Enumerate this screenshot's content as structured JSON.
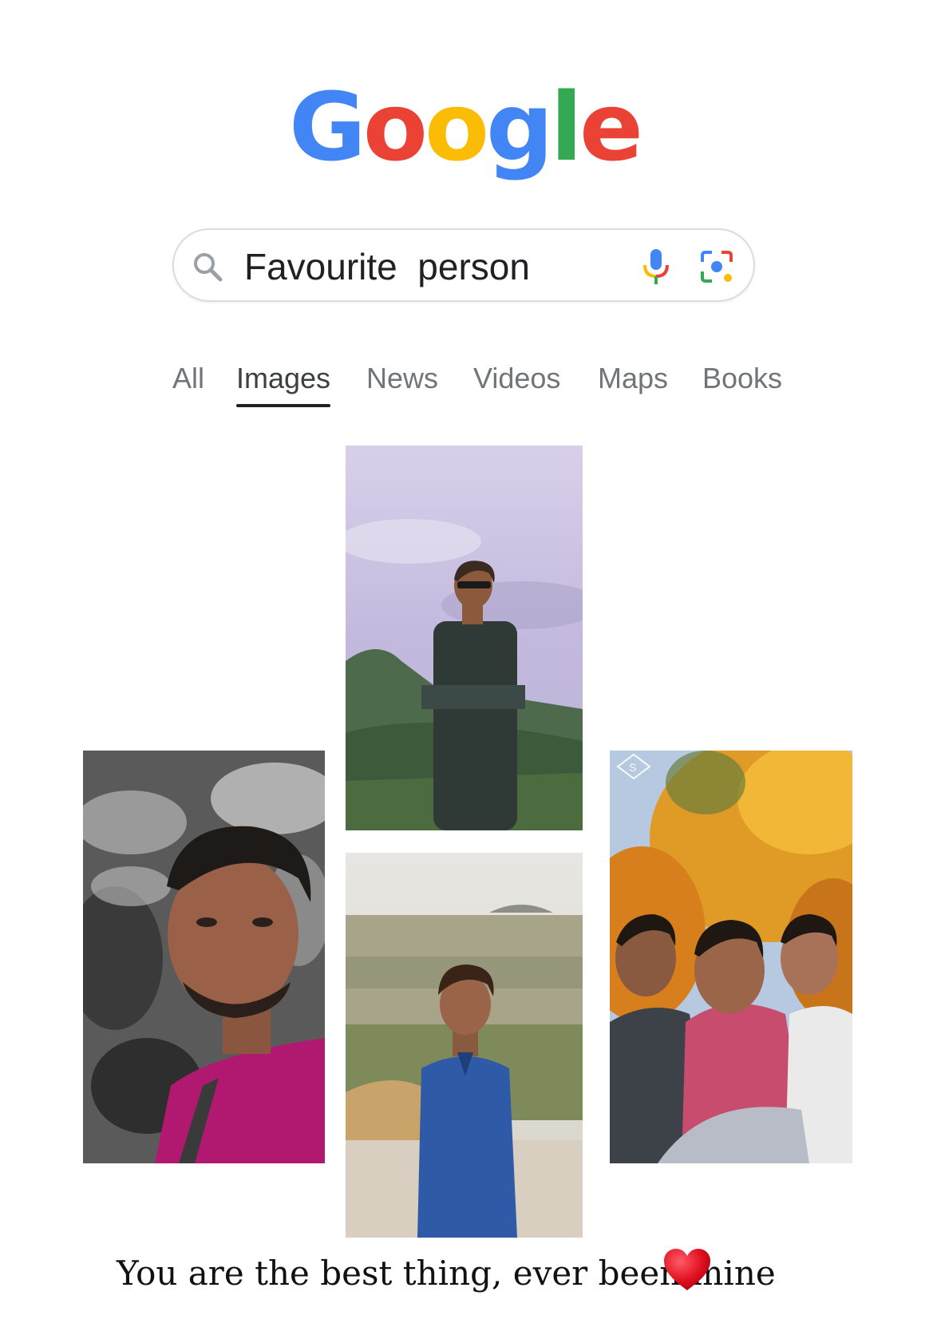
{
  "logo": {
    "letters": [
      "G",
      "o",
      "o",
      "g",
      "l",
      "e"
    ],
    "colors": [
      "#4285F4",
      "#EA4335",
      "#FBBC05",
      "#4285F4",
      "#34A853",
      "#EA4335"
    ]
  },
  "search": {
    "query": "Favourite  person",
    "icons": [
      "search-icon",
      "microphone-icon",
      "lens-icon"
    ]
  },
  "tabs": {
    "items": [
      "All",
      "Images",
      "News",
      "Videos",
      "Maps",
      "Books"
    ],
    "active": "Images"
  },
  "images": [
    {
      "name": "photo-man-on-hill-sunglasses",
      "subject": "young man with sunglasses, arms crossed, on a hilltop with cloudy purple sky"
    },
    {
      "name": "photo-selfie-pink-shirt",
      "subject": "close-up selfie of a young man in a pink shirt against stylised grey foliage"
    },
    {
      "name": "photo-man-blue-shirt-landscape",
      "subject": "young man in a blue shirt standing in front of a wide landscape"
    },
    {
      "name": "photo-three-friends-selfie",
      "subject": "three friends taking a selfie under an orange-leafed tree"
    }
  ],
  "caption": {
    "text": "You are the best thing, ever been mine",
    "emoji": "heart-icon"
  }
}
